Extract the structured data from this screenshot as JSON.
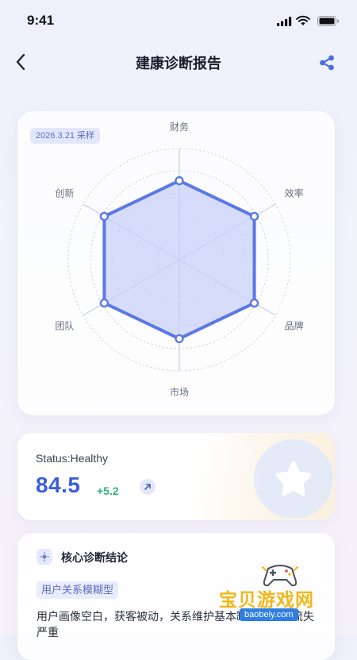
{
  "status_bar": {
    "time": "9:41"
  },
  "nav": {
    "title": "建康诊断报告"
  },
  "radar": {
    "sample_label": "2026.3.21 采样",
    "accent_color": "#5b78e6",
    "fill_color": "#c9d0f7"
  },
  "chart_data": {
    "type": "radar",
    "categories": [
      "财务",
      "效率",
      "品牌",
      "市场",
      "团队",
      "创新"
    ],
    "values": [
      0.71,
      0.78,
      0.78,
      0.71,
      0.78,
      0.78
    ],
    "scale": [
      0,
      1
    ],
    "rings": 5
  },
  "score": {
    "status": "Status:Healthy",
    "value": "84.5",
    "delta": "+5.2"
  },
  "conclusion": {
    "title": "核心诊断结论",
    "tag": "用户关系模糊型",
    "text": "用户画像空白，获客被动，关系维护基本缺失，用户流失严重"
  },
  "watermark": {
    "text": "宝贝游戏网",
    "url": "baobeiy.com"
  }
}
